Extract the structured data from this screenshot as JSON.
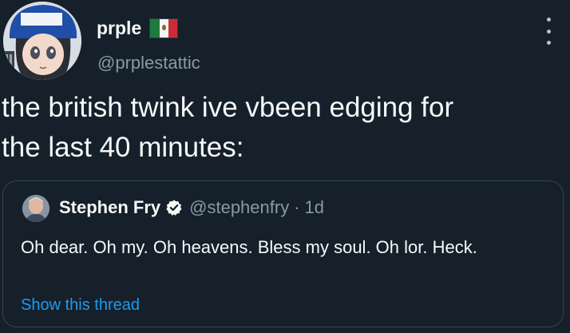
{
  "tweet": {
    "display_name": "prple",
    "handle": "@prplestattic",
    "text": "the british twink ive vbeen edging for\nthe last 40 minutes:",
    "icons": {
      "avatar": "avatar-image",
      "flag": "mexico-flag-icon",
      "more": "more-options-icon"
    }
  },
  "quote": {
    "name": "Stephen Fry",
    "handle": "@stephenfry",
    "separator": "·",
    "time": "1d",
    "text": "Oh dear. Oh my. Oh heavens. Bless my soul. Oh lor. Heck.",
    "show_thread_label": "Show this thread",
    "icons": {
      "verified": "verified-badge-icon",
      "avatar": "quote-avatar-image"
    }
  },
  "colors": {
    "background": "#15202b",
    "primary_text": "#f7f9f9",
    "secondary_text": "#8b98a5",
    "link": "#1d9bf0",
    "border": "#38444d"
  }
}
